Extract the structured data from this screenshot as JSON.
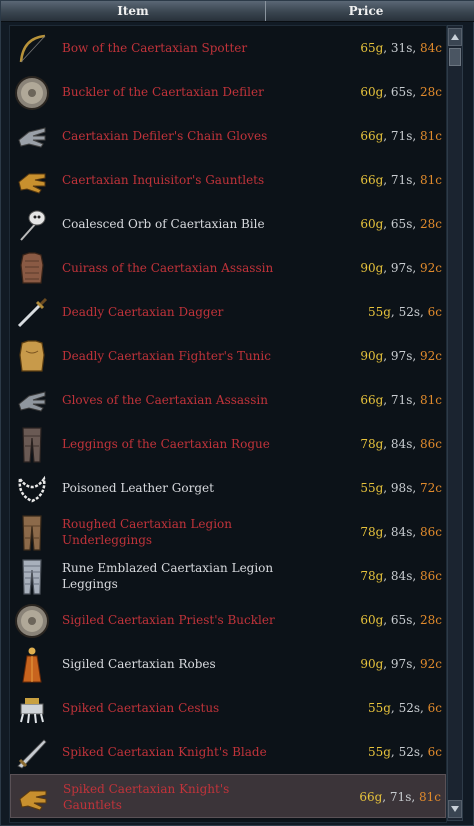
{
  "header": {
    "item_label": "Item",
    "price_label": "Price"
  },
  "items": [
    {
      "name": "Bow of the Caertaxian Spotter",
      "color": "red",
      "icon": "bow-icon",
      "gold": "65g",
      "silver": "31s",
      "copper": "84c"
    },
    {
      "name": "Buckler of the Caertaxian Defiler",
      "color": "red",
      "icon": "buckler-icon",
      "gold": "60g",
      "silver": "65s",
      "copper": "28c"
    },
    {
      "name": "Caertaxian Defiler's Chain Gloves",
      "color": "red",
      "icon": "chain-gloves-icon",
      "gold": "66g",
      "silver": "71s",
      "copper": "81c"
    },
    {
      "name": "Caertaxian Inquisitor's Gauntlets",
      "color": "red",
      "icon": "gauntlets-icon",
      "gold": "66g",
      "silver": "71s",
      "copper": "81c"
    },
    {
      "name": "Coalesced Orb of Caertaxian Bile",
      "color": "white",
      "icon": "orb-icon",
      "gold": "60g",
      "silver": "65s",
      "copper": "28c"
    },
    {
      "name": "Cuirass of the Caertaxian Assassin",
      "color": "red",
      "icon": "cuirass-icon",
      "gold": "90g",
      "silver": "97s",
      "copper": "92c"
    },
    {
      "name": "Deadly Caertaxian Dagger",
      "color": "red",
      "icon": "dagger-icon",
      "gold": "55g",
      "silver": "52s",
      "copper": "6c"
    },
    {
      "name": "Deadly Caertaxian Fighter's Tunic",
      "color": "red",
      "icon": "tunic-icon",
      "gold": "90g",
      "silver": "97s",
      "copper": "92c"
    },
    {
      "name": "Gloves of the Caertaxian Assassin",
      "color": "red",
      "icon": "gloves-icon",
      "gold": "66g",
      "silver": "71s",
      "copper": "81c"
    },
    {
      "name": "Leggings of the Caertaxian Rogue",
      "color": "red",
      "icon": "leggings-icon",
      "gold": "78g",
      "silver": "84s",
      "copper": "86c"
    },
    {
      "name": "Poisoned Leather Gorget",
      "color": "white",
      "icon": "gorget-icon",
      "gold": "55g",
      "silver": "98s",
      "copper": "72c"
    },
    {
      "name": "Roughed Caertaxian Legion Underleggings",
      "color": "red",
      "icon": "underleggings-icon",
      "gold": "78g",
      "silver": "84s",
      "copper": "86c"
    },
    {
      "name": "Rune Emblazed Caertaxian Legion Leggings",
      "color": "white",
      "icon": "chain-leggings-icon",
      "gold": "78g",
      "silver": "84s",
      "copper": "86c"
    },
    {
      "name": "Sigiled Caertaxian Priest's Buckler",
      "color": "red",
      "icon": "buckler-icon",
      "gold": "60g",
      "silver": "65s",
      "copper": "28c"
    },
    {
      "name": "Sigiled Caertaxian Robes",
      "color": "white",
      "icon": "robes-icon",
      "gold": "90g",
      "silver": "97s",
      "copper": "92c"
    },
    {
      "name": "Spiked Caertaxian Cestus",
      "color": "red",
      "icon": "cestus-icon",
      "gold": "55g",
      "silver": "52s",
      "copper": "6c"
    },
    {
      "name": "Spiked Caertaxian Knight's Blade",
      "color": "red",
      "icon": "blade-icon",
      "gold": "55g",
      "silver": "52s",
      "copper": "6c"
    },
    {
      "name": "Spiked Caertaxian Knight's Gauntlets",
      "color": "red",
      "icon": "gauntlets-icon",
      "gold": "66g",
      "silver": "71s",
      "copper": "81c",
      "selected": true
    }
  ],
  "colors": {
    "red_name": "#c0333a",
    "white_name": "#d8dade",
    "gold": "#e6c23c",
    "copper": "#e08a2c"
  }
}
